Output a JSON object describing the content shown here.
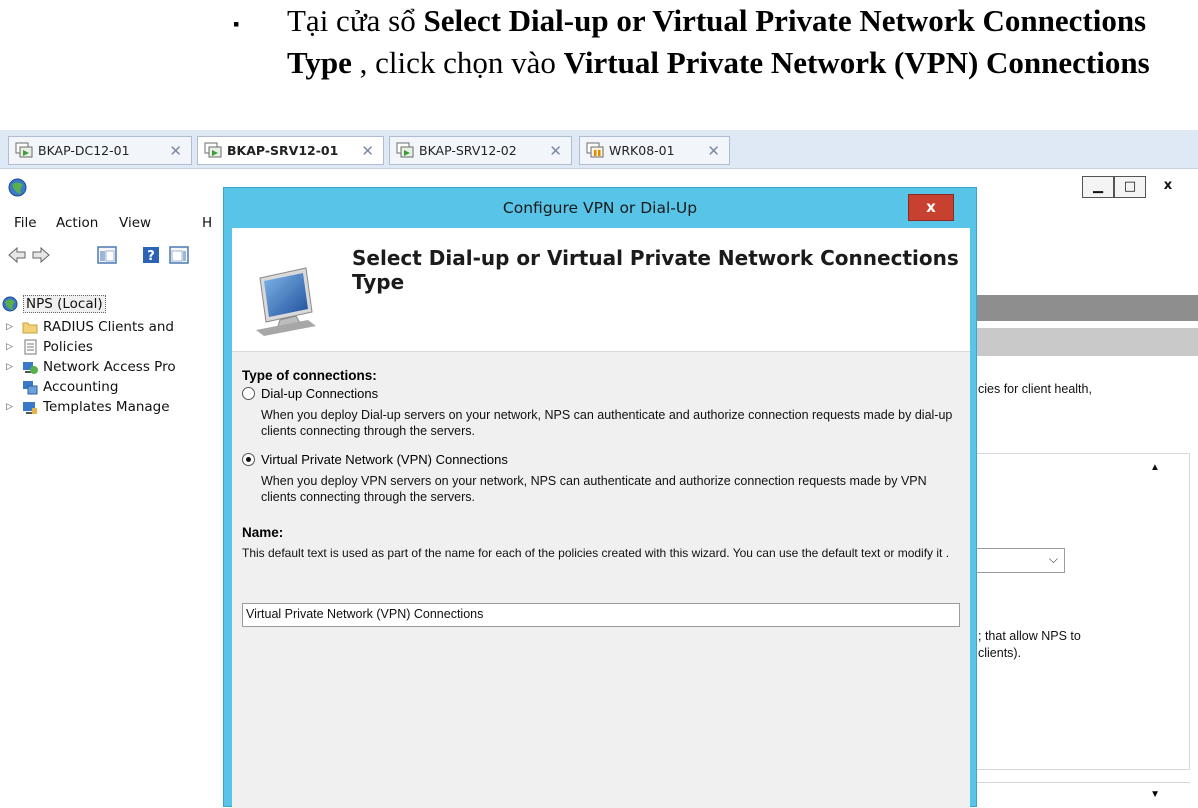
{
  "instruction": {
    "bullet": "▪",
    "prefix": "Tại cửa sổ ",
    "window_name": "Select Dial-up or Virtual Private Network Connections Type",
    "middle": " , click chọn vào ",
    "option_name": "Virtual Private Network (VPN) Connections"
  },
  "tabs": [
    {
      "label": "BKAP-DC12-01",
      "close": "✕"
    },
    {
      "label": "BKAP-SRV12-01",
      "close": "✕"
    },
    {
      "label": "BKAP-SRV12-02",
      "close": "✕"
    },
    {
      "label": "WRK08-01",
      "close": "✕"
    }
  ],
  "mmc": {
    "window_buttons": {
      "minimize": "▁",
      "maximize": "□",
      "close": "x"
    },
    "menu": [
      "File",
      "Action",
      "View",
      "H"
    ],
    "tree": {
      "root": "NPS (Local)",
      "items": [
        "RADIUS Clients and",
        "Policies",
        "Network Access Pro",
        "Accounting",
        "Templates Manage"
      ]
    },
    "right_pane": {
      "text1": "cies for client health,",
      "text2a": "; that allow NPS to",
      "text2b": "clients).",
      "scroll_up": "▲",
      "scroll_down": "▼",
      "dropdown_arrow": "⌵"
    }
  },
  "dialog": {
    "title": "Configure VPN or Dial-Up",
    "close": "x",
    "heading": "Select Dial-up or Virtual Private Network Connections Type",
    "type_label": "Type of connections:",
    "options": [
      {
        "label": "Dial-up Connections",
        "selected": false,
        "description": "When you deploy Dial-up servers on your network, NPS can authenticate and authorize connection requests made by dial-up clients connecting through the servers."
      },
      {
        "label": "Virtual Private Network (VPN) Connections",
        "selected": true,
        "description": "When you deploy VPN servers on your network, NPS can authenticate and authorize connection requests made by VPN clients connecting through the servers."
      }
    ],
    "name_label": "Name:",
    "name_description": "This default text is used as part of the name for each of the policies created with this wizard. You can use the default text or modify it .",
    "name_value": "Virtual Private Network (VPN) Connections"
  }
}
